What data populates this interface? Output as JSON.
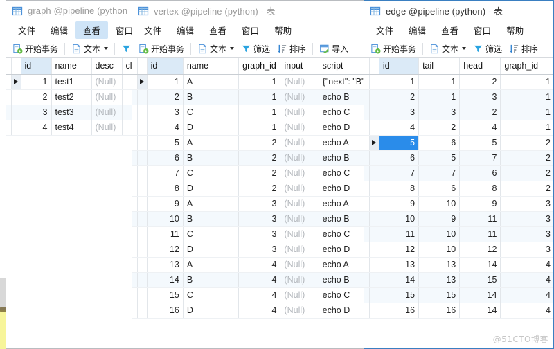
{
  "watermark": "@51CTO博客",
  "menu": {
    "items": [
      "文件",
      "编辑",
      "查看",
      "窗口",
      "帮助"
    ]
  },
  "toolbar": {
    "begin_transaction": "开始事务",
    "text": "文本",
    "filter": "筛选",
    "sort": "排序",
    "import": "导入"
  },
  "windows": [
    {
      "id": "graph",
      "title": "graph @pipeline (python) -",
      "icon": "table-grid-icon",
      "active": false,
      "menu": [
        "文件",
        "编辑",
        "查看",
        "窗口"
      ],
      "menu_highlight": "查看",
      "toolbar": [
        "开始事务",
        "文本",
        "筛选"
      ],
      "columns": [
        "id",
        "name",
        "desc",
        "cl"
      ],
      "rows": [
        {
          "id": "1",
          "name": "test1",
          "desc": "(Null)",
          "cl": ""
        },
        {
          "id": "2",
          "name": "test2",
          "desc": "(Null)",
          "cl": ""
        },
        {
          "id": "3",
          "name": "test3",
          "desc": "(Null)",
          "cl": ""
        },
        {
          "id": "4",
          "name": "test4",
          "desc": "(Null)",
          "cl": ""
        }
      ],
      "current_row": 0
    },
    {
      "id": "vertex",
      "title": "vertex @pipeline (python) - 表",
      "icon": "table-grid-icon",
      "active": false,
      "menu": [
        "文件",
        "编辑",
        "查看",
        "窗口",
        "帮助"
      ],
      "toolbar": [
        "开始事务",
        "文本",
        "筛选",
        "排序",
        "导入"
      ],
      "columns": [
        "id",
        "name",
        "graph_id",
        "input",
        "script"
      ],
      "rows": [
        {
          "id": "1",
          "name": "A",
          "graph_id": "1",
          "input": "(Null)",
          "script": "{\"next\": \"B\""
        },
        {
          "id": "2",
          "name": "B",
          "graph_id": "1",
          "input": "(Null)",
          "script": "echo  B"
        },
        {
          "id": "3",
          "name": "C",
          "graph_id": "1",
          "input": "(Null)",
          "script": "echo C"
        },
        {
          "id": "4",
          "name": "D",
          "graph_id": "1",
          "input": "(Null)",
          "script": "echo D"
        },
        {
          "id": "5",
          "name": "A",
          "graph_id": "2",
          "input": "(Null)",
          "script": "echo A"
        },
        {
          "id": "6",
          "name": "B",
          "graph_id": "2",
          "input": "(Null)",
          "script": "echo  B"
        },
        {
          "id": "7",
          "name": "C",
          "graph_id": "2",
          "input": "(Null)",
          "script": "echo C"
        },
        {
          "id": "8",
          "name": "D",
          "graph_id": "2",
          "input": "(Null)",
          "script": "echo D"
        },
        {
          "id": "9",
          "name": "A",
          "graph_id": "3",
          "input": "(Null)",
          "script": "echo A"
        },
        {
          "id": "10",
          "name": "B",
          "graph_id": "3",
          "input": "(Null)",
          "script": "echo  B"
        },
        {
          "id": "11",
          "name": "C",
          "graph_id": "3",
          "input": "(Null)",
          "script": "echo C"
        },
        {
          "id": "12",
          "name": "D",
          "graph_id": "3",
          "input": "(Null)",
          "script": "echo D"
        },
        {
          "id": "13",
          "name": "A",
          "graph_id": "4",
          "input": "(Null)",
          "script": "echo A"
        },
        {
          "id": "14",
          "name": "B",
          "graph_id": "4",
          "input": "(Null)",
          "script": "echo  B"
        },
        {
          "id": "15",
          "name": "C",
          "graph_id": "4",
          "input": "(Null)",
          "script": "echo C"
        },
        {
          "id": "16",
          "name": "D",
          "graph_id": "4",
          "input": "(Null)",
          "script": "echo D"
        }
      ],
      "current_row": 0
    },
    {
      "id": "edge",
      "title": "edge @pipeline (python) - 表",
      "icon": "table-grid-icon",
      "active": true,
      "menu": [
        "文件",
        "编辑",
        "查看",
        "窗口",
        "帮助"
      ],
      "toolbar": [
        "开始事务",
        "文本",
        "筛选",
        "排序"
      ],
      "columns": [
        "id",
        "tail",
        "head",
        "graph_id"
      ],
      "rows": [
        {
          "id": "1",
          "tail": "1",
          "head": "2",
          "graph_id": "1"
        },
        {
          "id": "2",
          "tail": "1",
          "head": "3",
          "graph_id": "1"
        },
        {
          "id": "3",
          "tail": "3",
          "head": "2",
          "graph_id": "1"
        },
        {
          "id": "4",
          "tail": "2",
          "head": "4",
          "graph_id": "1"
        },
        {
          "id": "5",
          "tail": "6",
          "head": "5",
          "graph_id": "2"
        },
        {
          "id": "6",
          "tail": "5",
          "head": "7",
          "graph_id": "2"
        },
        {
          "id": "7",
          "tail": "7",
          "head": "6",
          "graph_id": "2"
        },
        {
          "id": "8",
          "tail": "6",
          "head": "8",
          "graph_id": "2"
        },
        {
          "id": "9",
          "tail": "10",
          "head": "9",
          "graph_id": "3"
        },
        {
          "id": "10",
          "tail": "9",
          "head": "11",
          "graph_id": "3"
        },
        {
          "id": "11",
          "tail": "10",
          "head": "11",
          "graph_id": "3"
        },
        {
          "id": "12",
          "tail": "10",
          "head": "12",
          "graph_id": "3"
        },
        {
          "id": "13",
          "tail": "13",
          "head": "14",
          "graph_id": "4"
        },
        {
          "id": "14",
          "tail": "13",
          "head": "15",
          "graph_id": "4"
        },
        {
          "id": "15",
          "tail": "15",
          "head": "14",
          "graph_id": "4"
        },
        {
          "id": "16",
          "tail": "16",
          "head": "14",
          "graph_id": "4"
        }
      ],
      "current_row": 4,
      "selected_cell": {
        "row": 4,
        "column": "id"
      }
    }
  ],
  "colors": {
    "accent": "#2a8cea",
    "header_key": "#dbeaf7",
    "alt_row": "#f4f9fd",
    "active_border": "#3a7fc1",
    "null_text": "#b4b8bd"
  }
}
